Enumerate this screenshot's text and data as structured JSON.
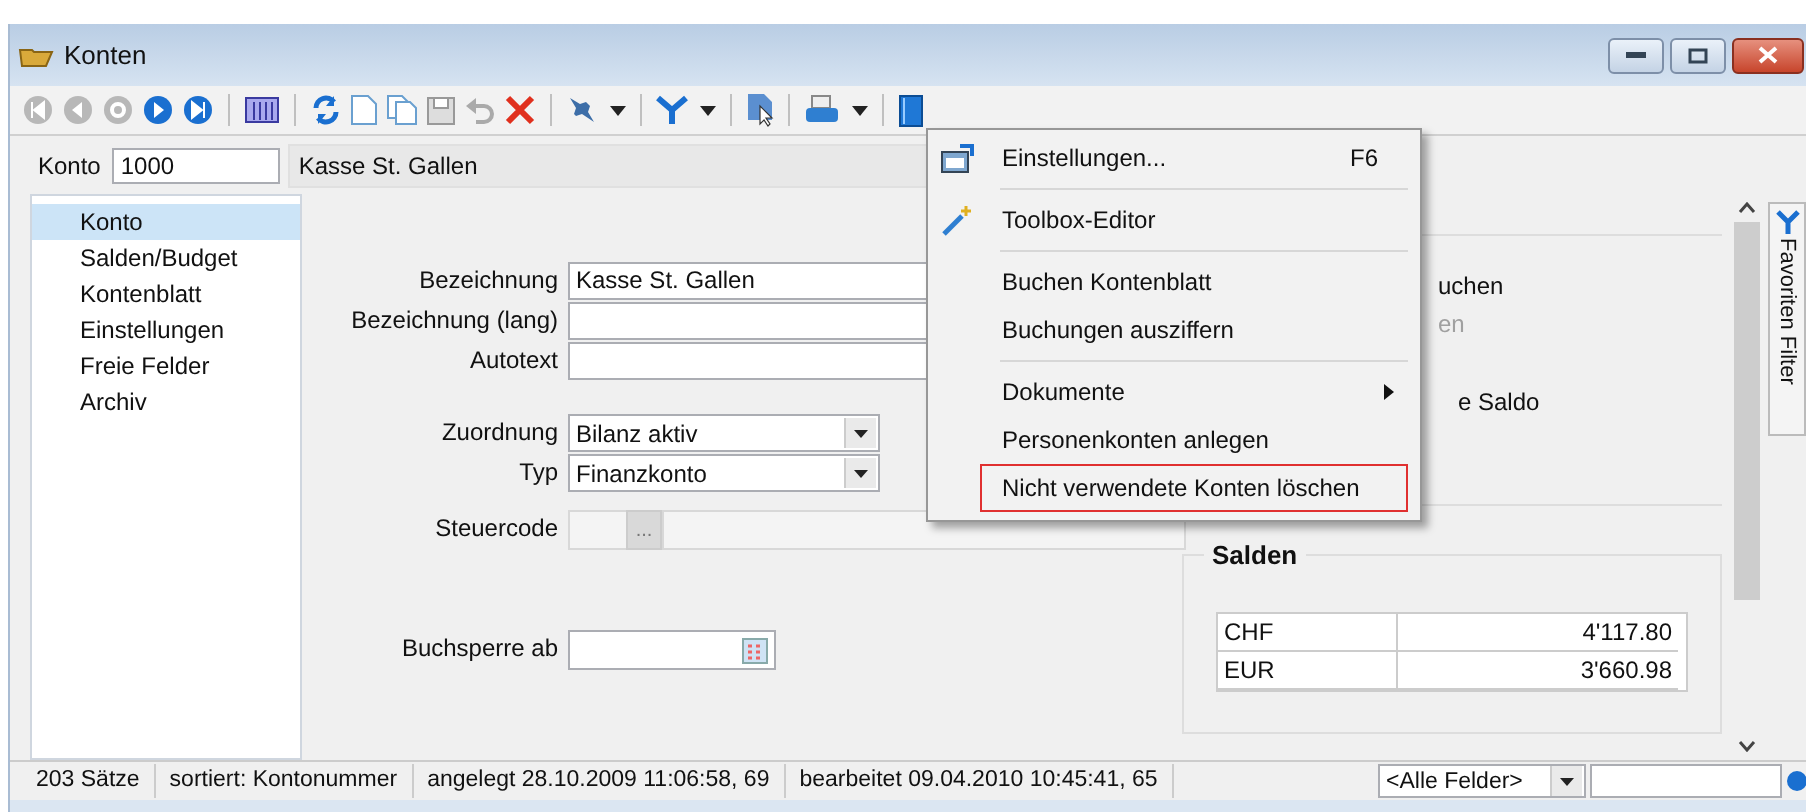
{
  "window": {
    "title": "Konten"
  },
  "record": {
    "label": "Konto",
    "number": "1000",
    "name": "Kasse St. Gallen"
  },
  "nav": [
    {
      "label": "Konto",
      "selected": true
    },
    {
      "label": "Salden/Budget",
      "selected": false
    },
    {
      "label": "Kontenblatt",
      "selected": false
    },
    {
      "label": "Einstellungen",
      "selected": false
    },
    {
      "label": "Freie Felder",
      "selected": false
    },
    {
      "label": "Archiv",
      "selected": false
    }
  ],
  "form": {
    "text_fields": [
      {
        "label": "Bezeichnung",
        "value": "Kasse St. Gallen"
      },
      {
        "label": "Bezeichnung (lang)"
      },
      {
        "label": "Autotext"
      }
    ],
    "dropdowns": [
      {
        "label": "Zuordnung",
        "value": "Bilanz aktiv"
      },
      {
        "label": "Typ",
        "value": "Finanzkonto"
      }
    ],
    "tax_code": {
      "label": "Steuercode",
      "button": "..."
    },
    "date_field": {
      "label": "Buchsperre ab"
    }
  },
  "right_panel": {
    "partial_texts": [
      {
        "text": "uchen",
        "disabled": false
      },
      {
        "text": "en",
        "disabled": true
      },
      {
        "text": "e Saldo",
        "disabled": false
      }
    ]
  },
  "balances": {
    "title": "Salden",
    "rows": [
      {
        "currency": "CHF",
        "amount": "4'117.80"
      },
      {
        "currency": "EUR",
        "amount": "3'660.98"
      }
    ]
  },
  "side_tab": {
    "label": "Favoriten Filter"
  },
  "context_menu": [
    {
      "kind": "item",
      "label": "Einstellungen...",
      "shortcut": "F6",
      "submenu": false,
      "highlighted": false
    },
    {
      "kind": "separator"
    },
    {
      "kind": "item",
      "label": "Toolbox-Editor",
      "submenu": false,
      "highlighted": false
    },
    {
      "kind": "separator"
    },
    {
      "kind": "item",
      "label": "Buchen Kontenblatt",
      "submenu": false,
      "highlighted": false
    },
    {
      "kind": "item",
      "label": "Buchungen ausziffern",
      "submenu": false,
      "highlighted": false
    },
    {
      "kind": "separator"
    },
    {
      "kind": "item",
      "label": "Dokumente",
      "submenu": true,
      "highlighted": false
    },
    {
      "kind": "item",
      "label": "Personenkonten anlegen",
      "submenu": false,
      "highlighted": false
    },
    {
      "kind": "item",
      "label": "Nicht verwendete Konten löschen",
      "submenu": false,
      "highlighted": true
    }
  ],
  "status_bar": {
    "count": "203 Sätze",
    "sort": "sortiert: Kontonummer",
    "created": "angelegt 28.10.2009 11:06:58, 69",
    "edited": "bearbeitet 09.04.2010 10:45:41, 65",
    "field_filter": "<Alle Felder>"
  }
}
